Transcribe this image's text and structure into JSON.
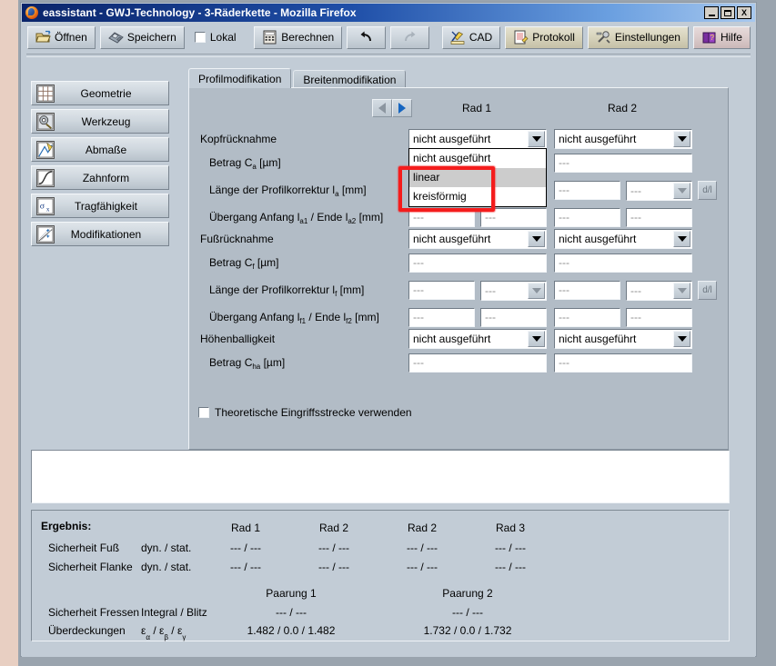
{
  "window": {
    "title": "eassistant - GWJ-Technology - 3-Räderkette - Mozilla Firefox",
    "app_icon": "firefox-icon",
    "minimize_label": "_",
    "maximize_label": "□",
    "close_label": "X"
  },
  "toolbar": {
    "items": [
      {
        "label": "Öffnen",
        "icon": "open-folder-icon",
        "style": "plain"
      },
      {
        "label": "Speichern",
        "icon": "floppy-disk-icon",
        "style": "plain"
      },
      {
        "label": "Lokal",
        "icon": "checkbox-icon",
        "style": "checkbox",
        "checked": false
      },
      {
        "label": "Berechnen",
        "icon": "calculator-icon",
        "style": "plain"
      },
      {
        "label": "",
        "icon": "undo-arrow-icon",
        "style": "plain"
      },
      {
        "label": "",
        "icon": "redo-arrow-icon",
        "style": "plain"
      },
      {
        "label": "CAD",
        "icon": "cad-pencil-icon",
        "style": "plain"
      },
      {
        "label": "Protokoll",
        "icon": "document-pencil-icon",
        "style": "olive"
      },
      {
        "label": "Einstellungen",
        "icon": "settings-tools-icon",
        "style": "olive"
      },
      {
        "label": "Hilfe",
        "icon": "help-book-icon",
        "style": "rose"
      }
    ]
  },
  "sidebar": {
    "items": [
      {
        "label": "Geometrie",
        "icon": "grid-icon"
      },
      {
        "label": "Werkzeug",
        "icon": "gear-tool-icon"
      },
      {
        "label": "Abmaße",
        "icon": "ruler-chart-icon"
      },
      {
        "label": "Zahnform",
        "icon": "tooth-profile-icon"
      },
      {
        "label": "Tragfähigkeit",
        "icon": "sigma-x-icon"
      },
      {
        "label": "Modifikationen",
        "icon": "modification-icon"
      }
    ]
  },
  "tabs": [
    {
      "label": "Profilmodifikation",
      "active": true
    },
    {
      "label": "Breitenmodifikation",
      "active": false
    }
  ],
  "nav": {
    "prev_icon": "chevron-left-icon",
    "next_icon": "chevron-right-icon"
  },
  "columns": {
    "rad1": "Rad 1",
    "rad2": "Rad 2"
  },
  "form": {
    "placeholder_dash": "---",
    "sections": [
      {
        "title": "Kopfrücknahme",
        "combo_rad1": "nicht ausgeführt",
        "combo_rad2": "nicht ausgeführt",
        "rows": [
          {
            "label_pre": "Betrag C",
            "label_sub": "a",
            "label_post": " [µm]"
          },
          {
            "label_pre": "Länge der Profilkorrektur l",
            "label_sub": "a",
            "label_post": " [mm]"
          },
          {
            "label_pre": "Übergang Anfang l",
            "label_sub": "a1",
            "label_post": " / Ende l",
            "label_sub2": "a2",
            "label_post2": " [mm]"
          }
        ]
      },
      {
        "title": "Fußrücknahme",
        "combo_rad1": "nicht ausgeführt",
        "combo_rad2": "nicht ausgeführt",
        "rows": [
          {
            "label_pre": "Betrag C",
            "label_sub": "f",
            "label_post": " [µm]"
          },
          {
            "label_pre": "Länge der Profilkorrektur l",
            "label_sub": "f",
            "label_post": " [mm]"
          },
          {
            "label_pre": "Übergang Anfang l",
            "label_sub": "f1",
            "label_post": " / Ende l",
            "label_sub2": "f2",
            "label_post2": " [mm]"
          }
        ]
      },
      {
        "title": "Höhenballigkeit",
        "combo_rad1": "nicht ausgeführt",
        "combo_rad2": "nicht ausgeführt",
        "rows": [
          {
            "label_pre": "Betrag C",
            "label_sub": "ha",
            "label_post": " [µm]"
          }
        ]
      }
    ],
    "dl_button_label": "d/l",
    "checkbox": {
      "label": "Theoretische Eingriffsstrecke verwenden",
      "checked": false
    }
  },
  "dropdown": {
    "open": true,
    "options": [
      "nicht ausgeführt",
      "linear",
      "kreisförmig"
    ],
    "selected_index": 1,
    "highlight_color": "#f41c1c"
  },
  "results": {
    "title": "Ergebnis:",
    "wheel_headers": [
      "Rad 1",
      "Rad 2",
      "Rad 2",
      "Rad 3"
    ],
    "rows": [
      {
        "label": "Sicherheit Fuß",
        "sub": "dyn. / stat.",
        "values": [
          "---  /  ---",
          "---  /  ---",
          "---  /  ---",
          "---  /  ---"
        ]
      },
      {
        "label": "Sicherheit Flanke",
        "sub": "dyn. / stat.",
        "values": [
          "---  /  ---",
          "---  /  ---",
          "---  /  ---",
          "---  /  ---"
        ]
      }
    ],
    "pair_headers": [
      "Paarung 1",
      "Paarung 2"
    ],
    "pair_rows": [
      {
        "label": "Sicherheit Fressen",
        "sub": "Integral / Blitz",
        "values": [
          "---    /    ---",
          "---    /    ---"
        ]
      },
      {
        "label": "Überdeckungen",
        "sub_eps": true,
        "values": [
          "1.482 /   0.0   / 1.482",
          "1.732 /   0.0   / 1.732"
        ]
      }
    ],
    "overlap_symbol": "ε"
  },
  "colors": {
    "panel": "#c2ccd6",
    "tab_body": "#b2bcc6",
    "title_start": "#0a246a",
    "accent_red": "#f41c1c",
    "blue_arrow": "#1565c0"
  }
}
